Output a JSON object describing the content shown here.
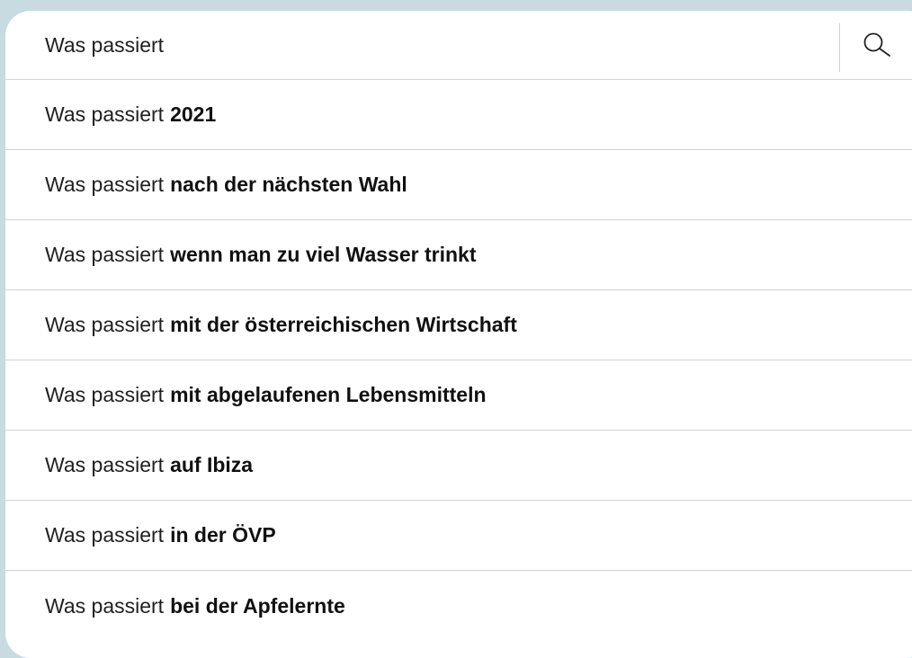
{
  "search": {
    "value": "Was passiert",
    "button_icon": "search-icon"
  },
  "suggestions": [
    {
      "prefix": "Was passiert",
      "completion": "2021"
    },
    {
      "prefix": "Was passiert",
      "completion": "nach der nächsten Wahl"
    },
    {
      "prefix": "Was passiert",
      "completion": "wenn man zu viel Wasser trinkt"
    },
    {
      "prefix": "Was passiert",
      "completion": "mit der österreichischen Wirtschaft"
    },
    {
      "prefix": "Was passiert",
      "completion": "mit abgelaufenen Lebensmitteln"
    },
    {
      "prefix": "Was passiert",
      "completion": "auf Ibiza"
    },
    {
      "prefix": "Was passiert",
      "completion": "in der ÖVP"
    },
    {
      "prefix": "Was passiert",
      "completion": "bei der Apfelernte"
    }
  ],
  "colors": {
    "background": "#c7dbe1",
    "card": "#ffffff",
    "divider": "#d3d3d3",
    "text": "#1f1f1f"
  }
}
